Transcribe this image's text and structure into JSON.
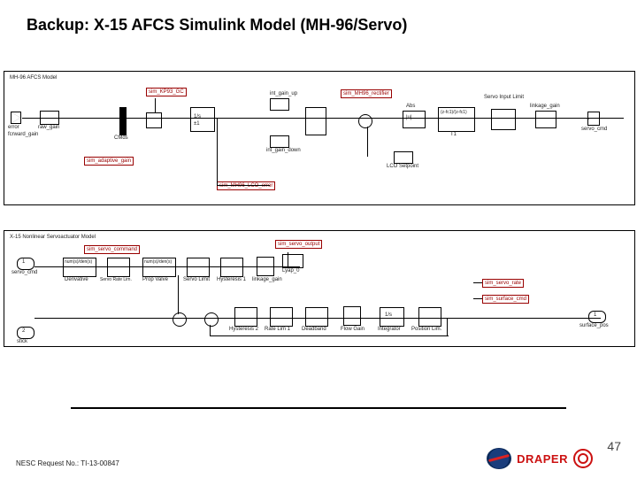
{
  "title": "Backup: X-15 AFCS Simulink Model (MH-96/Servo)",
  "footer": "NESC Request No.: TI-13-00847",
  "page_number": "47",
  "logo_text": "DRAPER",
  "diagram1": {
    "caption": "MH-96 AFCS Model",
    "blocks": {
      "kp93": "sim_KP93_GC",
      "adapt": "sim_adaptive_gain",
      "int_up": "int_gain_up",
      "int_dn": "int_gain_down",
      "rectifier": "sim_MH96_rectifier",
      "lco_error": "sim_MH96_LCO_error",
      "abs": "Abs",
      "servo_limit": "Servo Input Limit",
      "linkage": "linkage_gain",
      "servo_cmd": "servo_cmd",
      "error": "error",
      "raw_gain": "raw_gain",
      "fwd_gain": "fcrward_gain",
      "cmds": "CMds",
      "lco": "LCO Setpoint",
      "tf1": "(z-fc1)/(z-fc1)",
      "tf1b": "T1",
      "int": "1/s",
      "int_b": "±1"
    }
  },
  "diagram2": {
    "caption": "X-15 Nonlinear Servoactuator Model",
    "blocks": {
      "servo_cmd_in": "servo_cmd",
      "stick": "stick",
      "derivative": "Derivative",
      "rate_lim": "Servo Rate Lim.",
      "tf1": "num(s)/den(s)",
      "tf2": "num(s)/den(s)",
      "prop_valve": "Prop Valve",
      "servo_lim": "Servo Limit",
      "hyst1": "Hysteresis 1",
      "linkage": "linkage_gain",
      "servo_cmd_red": "sim_servo_command",
      "servo_out": "sim_servo_output",
      "servo_rate": "sim_servo_rate",
      "surface_cmd": "sim_surface_cmd",
      "surface_pos": "surface_pos",
      "hyst2": "Hysteresis 2",
      "rate_lim2": "Rate Lim 1",
      "deadband": "Deadband",
      "flow_gain": "Flow Gain",
      "integrator": "Integrator",
      "pos_lim": "Position Lim.",
      "int_s": "1/s",
      "lyap": "Lyap_0"
    }
  }
}
